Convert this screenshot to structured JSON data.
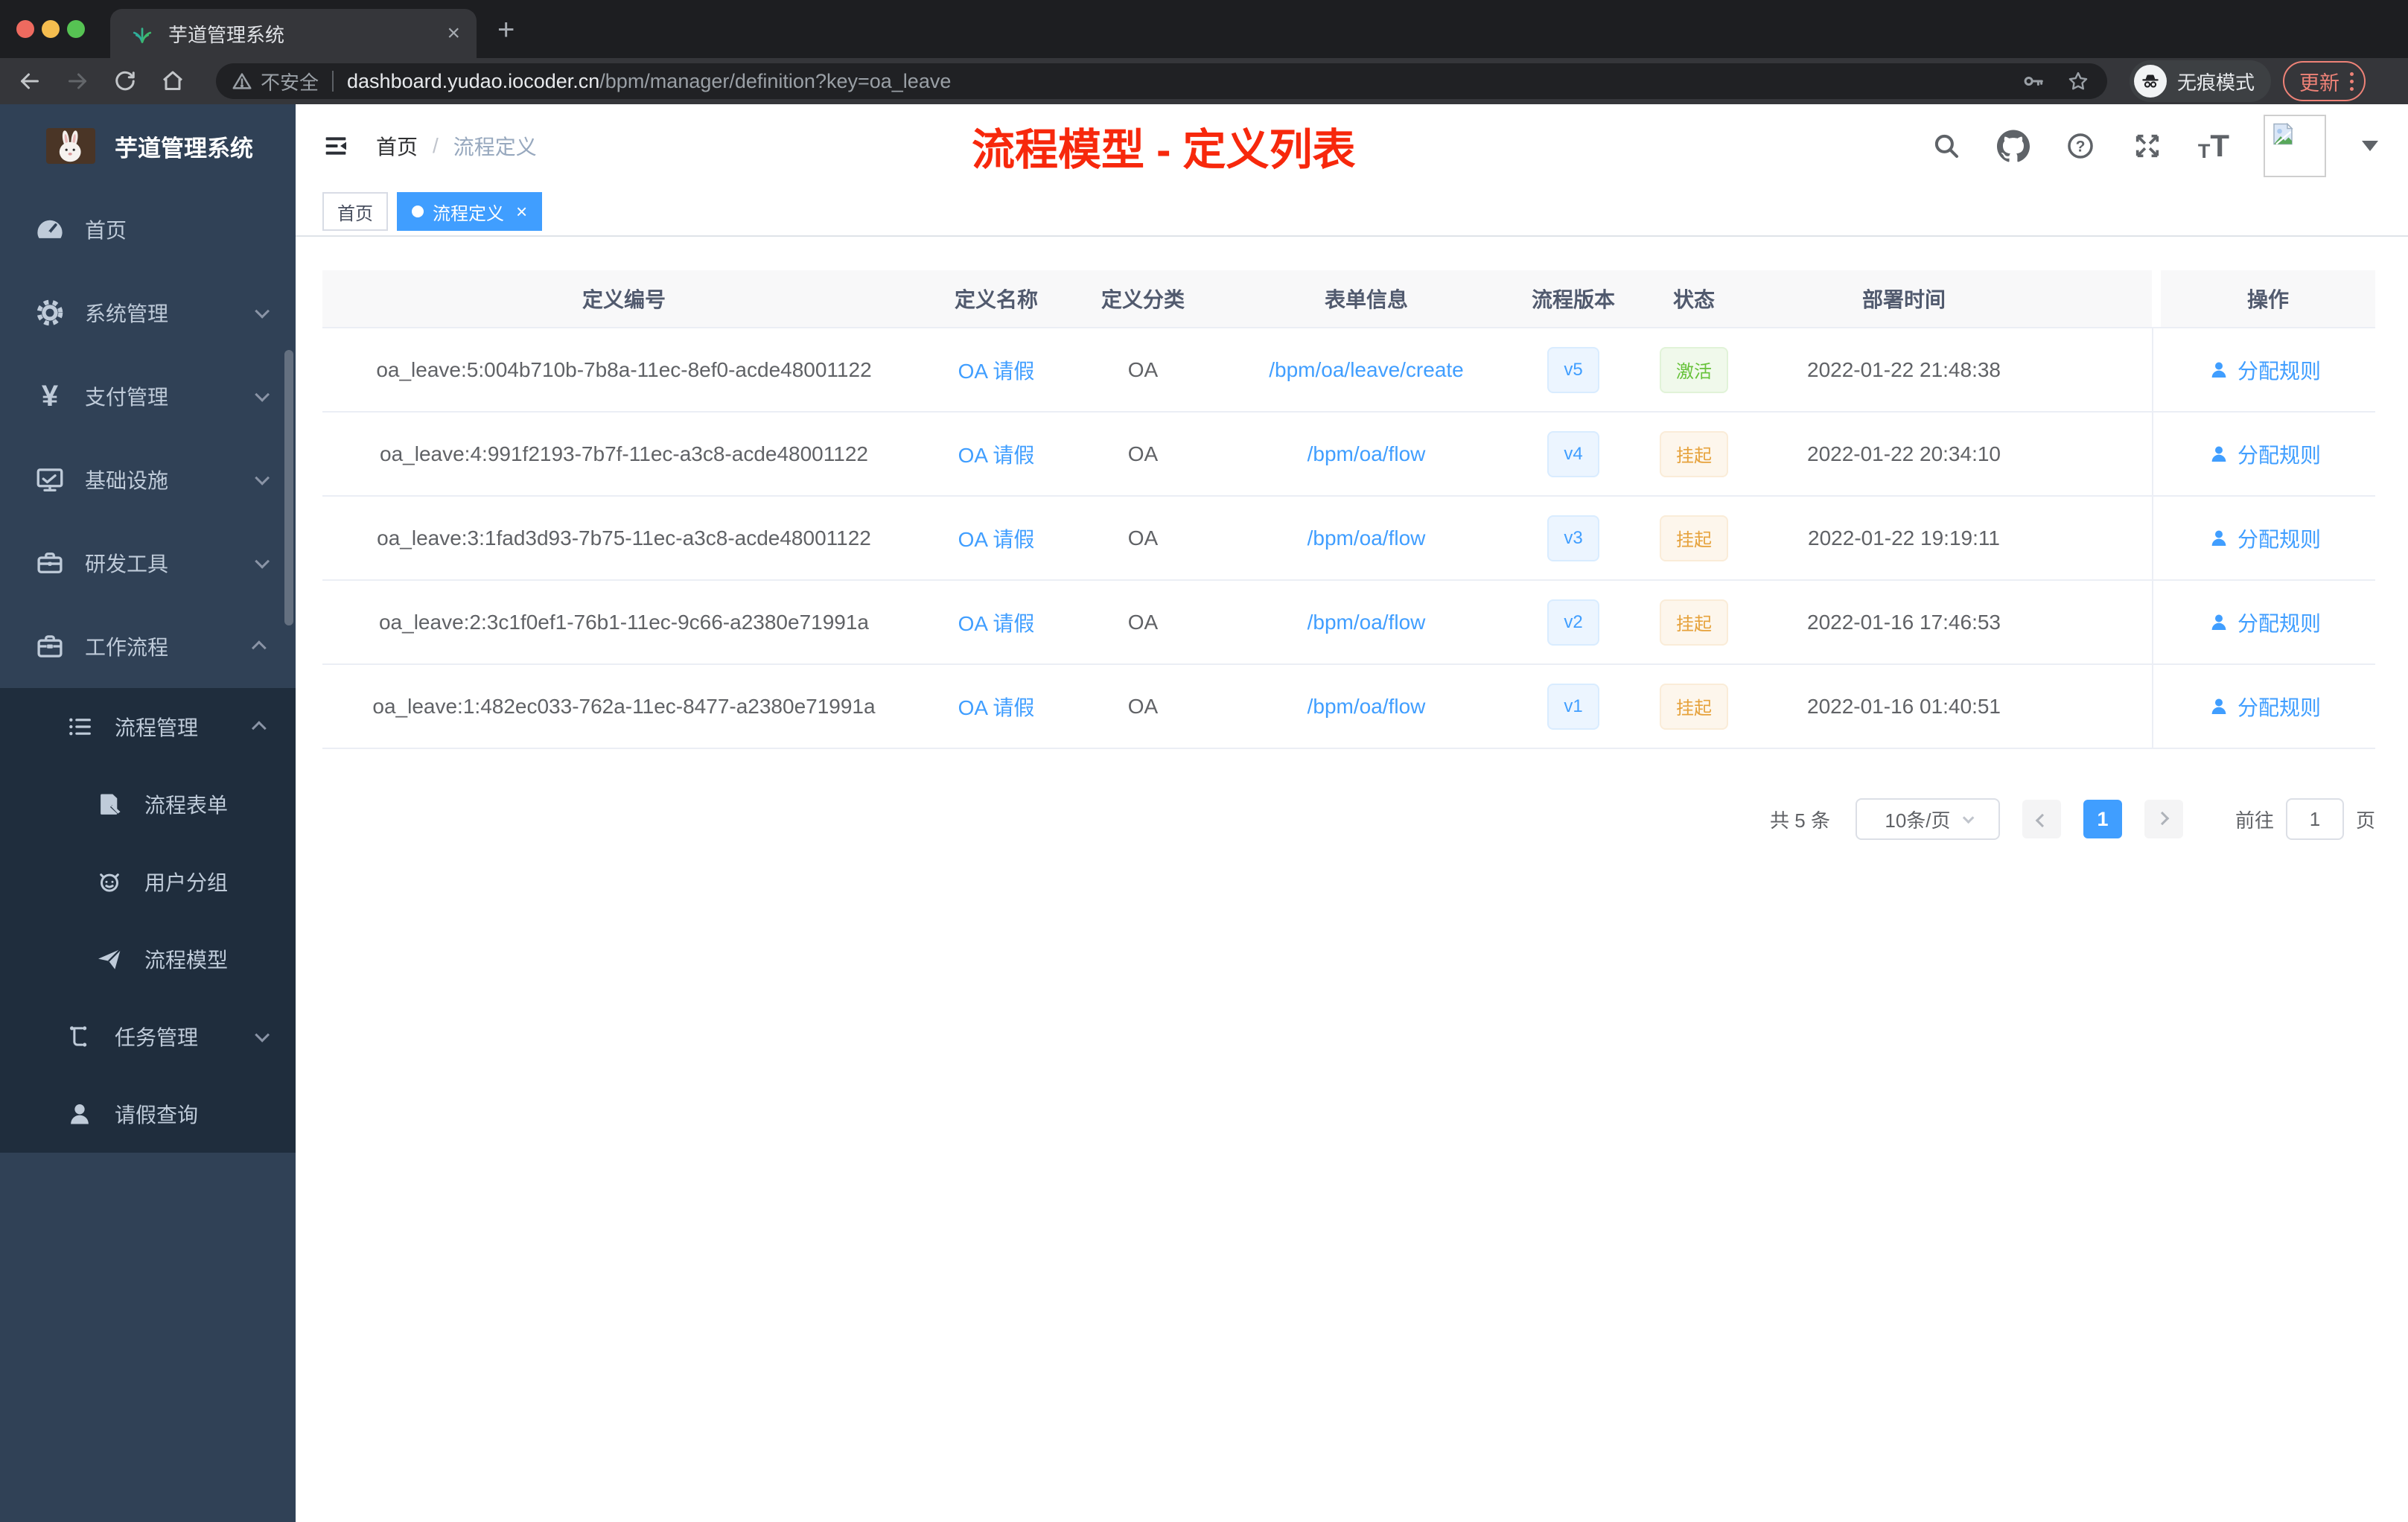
{
  "browser": {
    "tab_title": "芋道管理系统",
    "new_tab": "+",
    "close_tab": "×",
    "security_label": "不安全",
    "url_domain": "dashboard.yudao.iocoder.cn",
    "url_path": "/bpm/manager/definition?key=oa_leave",
    "incognito_label": "无痕模式",
    "update_label": "更新"
  },
  "sidebar": {
    "logo_title": "芋道管理系统",
    "items": [
      {
        "label": "首页"
      },
      {
        "label": "系统管理"
      },
      {
        "label": "支付管理"
      },
      {
        "label": "基础设施"
      },
      {
        "label": "研发工具"
      },
      {
        "label": "工作流程"
      },
      {
        "label": "流程管理"
      },
      {
        "label": "流程表单"
      },
      {
        "label": "用户分组"
      },
      {
        "label": "流程模型"
      },
      {
        "label": "任务管理"
      },
      {
        "label": "请假查询"
      }
    ]
  },
  "header": {
    "breadcrumb_home": "首页",
    "breadcrumb_current": "流程定义",
    "annotation_title": "流程模型 - 定义列表"
  },
  "tags": [
    {
      "label": "首页",
      "active": false
    },
    {
      "label": "流程定义",
      "active": true
    }
  ],
  "table": {
    "columns": [
      "定义编号",
      "定义名称",
      "定义分类",
      "表单信息",
      "流程版本",
      "状态",
      "部署时间",
      "操作"
    ],
    "rows": [
      {
        "id": "oa_leave:5:004b710b-7b8a-11ec-8ef0-acde48001122",
        "name": "OA 请假",
        "category": "OA",
        "form": "/bpm/oa/leave/create",
        "version": "v5",
        "status": "激活",
        "deployed_at": "2022-01-22 21:48:38",
        "action": "分配规则"
      },
      {
        "id": "oa_leave:4:991f2193-7b7f-11ec-a3c8-acde48001122",
        "name": "OA 请假",
        "category": "OA",
        "form": "/bpm/oa/flow",
        "version": "v4",
        "status": "挂起",
        "deployed_at": "2022-01-22 20:34:10",
        "action": "分配规则"
      },
      {
        "id": "oa_leave:3:1fad3d93-7b75-11ec-a3c8-acde48001122",
        "name": "OA 请假",
        "category": "OA",
        "form": "/bpm/oa/flow",
        "version": "v3",
        "status": "挂起",
        "deployed_at": "2022-01-22 19:19:11",
        "action": "分配规则"
      },
      {
        "id": "oa_leave:2:3c1f0ef1-76b1-11ec-9c66-a2380e71991a",
        "name": "OA 请假",
        "category": "OA",
        "form": "/bpm/oa/flow",
        "version": "v2",
        "status": "挂起",
        "deployed_at": "2022-01-16 17:46:53",
        "action": "分配规则"
      },
      {
        "id": "oa_leave:1:482ec033-762a-11ec-8477-a2380e71991a",
        "name": "OA 请假",
        "category": "OA",
        "form": "/bpm/oa/flow",
        "version": "v1",
        "status": "挂起",
        "deployed_at": "2022-01-16 01:40:51",
        "action": "分配规则"
      }
    ]
  },
  "pagination": {
    "total_label": "共 5 条",
    "page_size": "10条/页",
    "current_page": "1",
    "goto_label": "前往",
    "goto_page": "1",
    "page_unit": "页"
  },
  "colors": {
    "accent": "#409eff",
    "annotation_red": "#f7280c",
    "status_active_green": "#67c23a",
    "status_suspended_orange": "#e6a23c",
    "sidebar_bg": "#304156",
    "submenu_bg": "#1f2d3d"
  }
}
